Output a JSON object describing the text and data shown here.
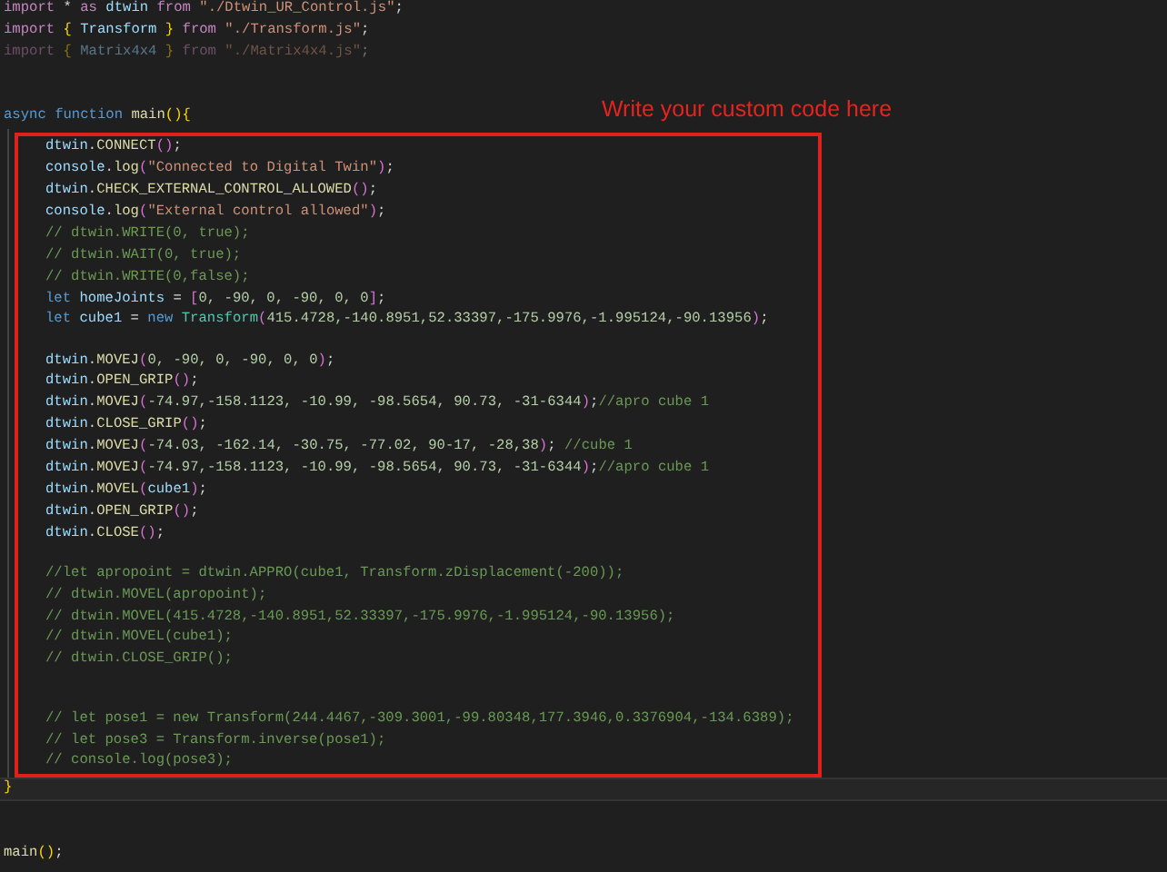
{
  "header_lines": [
    {
      "kind": "code",
      "dimmed": false,
      "segments": [
        {
          "text": "import",
          "kind": "keyword"
        },
        {
          "text": " *",
          "kind": "plain"
        },
        {
          "text": " as",
          "kind": "keyword"
        },
        {
          "text": " dtwin",
          "kind": "variable"
        },
        {
          "text": " from",
          "kind": "keyword"
        },
        {
          "text": " \"./Dtwin_UR_Control.js\"",
          "kind": "string"
        },
        {
          "text": ";",
          "kind": "plain"
        }
      ]
    },
    {
      "kind": "code",
      "dimmed": false,
      "segments": [
        {
          "text": "import",
          "kind": "keyword"
        },
        {
          "text": " {",
          "kind": "bracket"
        },
        {
          "text": " Transform",
          "kind": "variable"
        },
        {
          "text": " }",
          "kind": "bracket"
        },
        {
          "text": " from",
          "kind": "keyword"
        },
        {
          "text": " \"./Transform.js\"",
          "kind": "string"
        },
        {
          "text": ";",
          "kind": "plain"
        }
      ]
    },
    {
      "kind": "code",
      "dimmed": true,
      "segments": [
        {
          "text": "import",
          "kind": "keyword"
        },
        {
          "text": " {",
          "kind": "bracket"
        },
        {
          "text": " Matrix4x4",
          "kind": "variable"
        },
        {
          "text": " }",
          "kind": "bracket"
        },
        {
          "text": " from",
          "kind": "keyword"
        },
        {
          "text": " \"./Matrix4x4.js\"",
          "kind": "string"
        },
        {
          "text": ";",
          "kind": "plain"
        }
      ]
    },
    {
      "kind": "blank"
    },
    {
      "kind": "blank"
    }
  ],
  "function_line": {
    "segments": [
      {
        "text": "async function",
        "kind": "storage"
      },
      {
        "text": " main",
        "kind": "function"
      },
      {
        "text": "(){",
        "kind": "bracket"
      }
    ]
  },
  "annotation": {
    "label": "Write your custom code here"
  },
  "highlighted_lines": [
    {
      "kind": "code",
      "dimmed": false,
      "segments": [
        {
          "text": "dtwin",
          "kind": "variable"
        },
        {
          "text": ".",
          "kind": "plain"
        },
        {
          "text": "CONNECT",
          "kind": "function"
        },
        {
          "text": "()",
          "kind": "bracket2"
        },
        {
          "text": ";",
          "kind": "plain"
        }
      ]
    },
    {
      "kind": "code",
      "dimmed": false,
      "segments": [
        {
          "text": "console",
          "kind": "variable"
        },
        {
          "text": ".",
          "kind": "plain"
        },
        {
          "text": "log",
          "kind": "function"
        },
        {
          "text": "(",
          "kind": "bracket2"
        },
        {
          "text": "\"Connected to Digital Twin\"",
          "kind": "string"
        },
        {
          "text": ")",
          "kind": "bracket2"
        },
        {
          "text": ";",
          "kind": "plain"
        }
      ]
    },
    {
      "kind": "code",
      "dimmed": false,
      "segments": [
        {
          "text": "dtwin",
          "kind": "variable"
        },
        {
          "text": ".",
          "kind": "plain"
        },
        {
          "text": "CHECK_EXTERNAL_CONTROL_ALLOWED",
          "kind": "function"
        },
        {
          "text": "()",
          "kind": "bracket2"
        },
        {
          "text": ";",
          "kind": "plain"
        }
      ]
    },
    {
      "kind": "code",
      "dimmed": false,
      "segments": [
        {
          "text": "console",
          "kind": "variable"
        },
        {
          "text": ".",
          "kind": "plain"
        },
        {
          "text": "log",
          "kind": "function"
        },
        {
          "text": "(",
          "kind": "bracket2"
        },
        {
          "text": "\"External control allowed\"",
          "kind": "string"
        },
        {
          "text": ")",
          "kind": "bracket2"
        },
        {
          "text": ";",
          "kind": "plain"
        }
      ]
    },
    {
      "kind": "code",
      "dimmed": false,
      "segments": [
        {
          "text": "// dtwin.WRITE(0, true);",
          "kind": "comment"
        }
      ]
    },
    {
      "kind": "code",
      "dimmed": false,
      "segments": [
        {
          "text": "// dtwin.WAIT(0, true);",
          "kind": "comment"
        }
      ]
    },
    {
      "kind": "code",
      "dimmed": false,
      "segments": [
        {
          "text": "// dtwin.WRITE(0,false);",
          "kind": "comment"
        }
      ]
    },
    {
      "kind": "code",
      "dimmed": false,
      "segments": [
        {
          "text": "let",
          "kind": "storage"
        },
        {
          "text": " homeJoints",
          "kind": "variable"
        },
        {
          "text": " =",
          "kind": "plain"
        },
        {
          "text": " [",
          "kind": "bracket2"
        },
        {
          "text": "0, -90, 0, -90, 0, 0",
          "kind": "number"
        },
        {
          "text": "]",
          "kind": "bracket2"
        },
        {
          "text": ";",
          "kind": "plain"
        }
      ]
    },
    {
      "kind": "code",
      "dimmed": false,
      "segments": [
        {
          "text": "let",
          "kind": "storage"
        },
        {
          "text": " cube1",
          "kind": "variable"
        },
        {
          "text": " =",
          "kind": "plain"
        },
        {
          "text": " new",
          "kind": "storage"
        },
        {
          "text": " Transform",
          "kind": "type"
        },
        {
          "text": "(",
          "kind": "bracket2"
        },
        {
          "text": "415.4728,-140.8951,52.33397,-175.9976,-1.995124,-90.13956",
          "kind": "number"
        },
        {
          "text": ")",
          "kind": "bracket2"
        },
        {
          "text": ";",
          "kind": "plain"
        }
      ]
    },
    {
      "kind": "blank"
    },
    {
      "kind": "code",
      "dimmed": false,
      "segments": [
        {
          "text": "dtwin",
          "kind": "variable"
        },
        {
          "text": ".",
          "kind": "plain"
        },
        {
          "text": "MOVEJ",
          "kind": "function"
        },
        {
          "text": "(",
          "kind": "bracket2"
        },
        {
          "text": "0, -90, 0, -90, 0, 0",
          "kind": "number"
        },
        {
          "text": ")",
          "kind": "bracket2"
        },
        {
          "text": ";",
          "kind": "plain"
        }
      ]
    },
    {
      "kind": "code",
      "dimmed": false,
      "segments": [
        {
          "text": "dtwin",
          "kind": "variable"
        },
        {
          "text": ".",
          "kind": "plain"
        },
        {
          "text": "OPEN_GRIP",
          "kind": "function"
        },
        {
          "text": "()",
          "kind": "bracket2"
        },
        {
          "text": ";",
          "kind": "plain"
        }
      ]
    },
    {
      "kind": "code",
      "dimmed": false,
      "segments": [
        {
          "text": "dtwin",
          "kind": "variable"
        },
        {
          "text": ".",
          "kind": "plain"
        },
        {
          "text": "MOVEJ",
          "kind": "function"
        },
        {
          "text": "(",
          "kind": "bracket2"
        },
        {
          "text": "-74.97,-158.1123, -10.99, -98.5654, 90.73, -31-6344",
          "kind": "number"
        },
        {
          "text": ")",
          "kind": "bracket2"
        },
        {
          "text": ";",
          "kind": "plain"
        },
        {
          "text": "//apro cube 1",
          "kind": "comment"
        }
      ]
    },
    {
      "kind": "code",
      "dimmed": false,
      "segments": [
        {
          "text": "dtwin",
          "kind": "variable"
        },
        {
          "text": ".",
          "kind": "plain"
        },
        {
          "text": "CLOSE_GRIP",
          "kind": "function"
        },
        {
          "text": "()",
          "kind": "bracket2"
        },
        {
          "text": ";",
          "kind": "plain"
        }
      ]
    },
    {
      "kind": "code",
      "dimmed": false,
      "segments": [
        {
          "text": "dtwin",
          "kind": "variable"
        },
        {
          "text": ".",
          "kind": "plain"
        },
        {
          "text": "MOVEJ",
          "kind": "function"
        },
        {
          "text": "(",
          "kind": "bracket2"
        },
        {
          "text": "-74.03, -162.14, -30.75, -77.02, 90-17, -28,38",
          "kind": "number"
        },
        {
          "text": ")",
          "kind": "bracket2"
        },
        {
          "text": ";",
          "kind": "plain"
        },
        {
          "text": " //cube 1",
          "kind": "comment"
        }
      ]
    },
    {
      "kind": "code",
      "dimmed": false,
      "segments": [
        {
          "text": "dtwin",
          "kind": "variable"
        },
        {
          "text": ".",
          "kind": "plain"
        },
        {
          "text": "MOVEJ",
          "kind": "function"
        },
        {
          "text": "(",
          "kind": "bracket2"
        },
        {
          "text": "-74.97,-158.1123, -10.99, -98.5654, 90.73, -31-6344",
          "kind": "number"
        },
        {
          "text": ")",
          "kind": "bracket2"
        },
        {
          "text": ";",
          "kind": "plain"
        },
        {
          "text": "//apro cube 1",
          "kind": "comment"
        }
      ]
    },
    {
      "kind": "code",
      "dimmed": false,
      "segments": [
        {
          "text": "dtwin",
          "kind": "variable"
        },
        {
          "text": ".",
          "kind": "plain"
        },
        {
          "text": "MOVEL",
          "kind": "function"
        },
        {
          "text": "(",
          "kind": "bracket2"
        },
        {
          "text": "cube1",
          "kind": "variable"
        },
        {
          "text": ")",
          "kind": "bracket2"
        },
        {
          "text": ";",
          "kind": "plain"
        }
      ]
    },
    {
      "kind": "code",
      "dimmed": false,
      "segments": [
        {
          "text": "dtwin",
          "kind": "variable"
        },
        {
          "text": ".",
          "kind": "plain"
        },
        {
          "text": "OPEN_GRIP",
          "kind": "function"
        },
        {
          "text": "()",
          "kind": "bracket2"
        },
        {
          "text": ";",
          "kind": "plain"
        }
      ]
    },
    {
      "kind": "code",
      "dimmed": false,
      "segments": [
        {
          "text": "dtwin",
          "kind": "variable"
        },
        {
          "text": ".",
          "kind": "plain"
        },
        {
          "text": "CLOSE",
          "kind": "function"
        },
        {
          "text": "()",
          "kind": "bracket2"
        },
        {
          "text": ";",
          "kind": "plain"
        }
      ]
    },
    {
      "kind": "blank"
    },
    {
      "kind": "code",
      "dimmed": false,
      "segments": [
        {
          "text": "//let apropoint = dtwin.APPRO(cube1, Transform.zDisplacement(-200));",
          "kind": "comment"
        }
      ]
    },
    {
      "kind": "code",
      "dimmed": false,
      "segments": [
        {
          "text": "// dtwin.MOVEL(apropoint);",
          "kind": "comment"
        }
      ]
    },
    {
      "kind": "code",
      "dimmed": false,
      "segments": [
        {
          "text": "// dtwin.MOVEL(415.4728,-140.8951,52.33397,-175.9976,-1.995124,-90.13956);",
          "kind": "comment"
        }
      ]
    },
    {
      "kind": "code",
      "dimmed": false,
      "segments": [
        {
          "text": "// dtwin.MOVEL(cube1);",
          "kind": "comment"
        }
      ]
    },
    {
      "kind": "code",
      "dimmed": false,
      "segments": [
        {
          "text": "// dtwin.CLOSE_GRIP();",
          "kind": "comment"
        }
      ]
    },
    {
      "kind": "blank"
    },
    {
      "kind": "blank"
    },
    {
      "kind": "code",
      "dimmed": false,
      "segments": [
        {
          "text": "// let pose1 = new Transform(244.4467,-309.3001,-99.80348,177.3946,0.3376904,-134.6389);",
          "kind": "comment"
        }
      ]
    },
    {
      "kind": "code",
      "dimmed": false,
      "segments": [
        {
          "text": "// let pose3 = Transform.inverse(pose1);",
          "kind": "comment"
        }
      ]
    },
    {
      "kind": "code",
      "dimmed": false,
      "segments": [
        {
          "text": "// console.log(pose3);",
          "kind": "comment"
        }
      ]
    }
  ],
  "closing_line": {
    "segments": [
      {
        "text": "}",
        "kind": "bracket"
      }
    ]
  },
  "footer_lines": [
    {
      "kind": "blank"
    },
    {
      "kind": "blank"
    },
    {
      "kind": "code",
      "dimmed": false,
      "segments": [
        {
          "text": "main",
          "kind": "function"
        },
        {
          "text": "()",
          "kind": "bracket"
        },
        {
          "text": ";",
          "kind": "plain"
        }
      ]
    }
  ]
}
